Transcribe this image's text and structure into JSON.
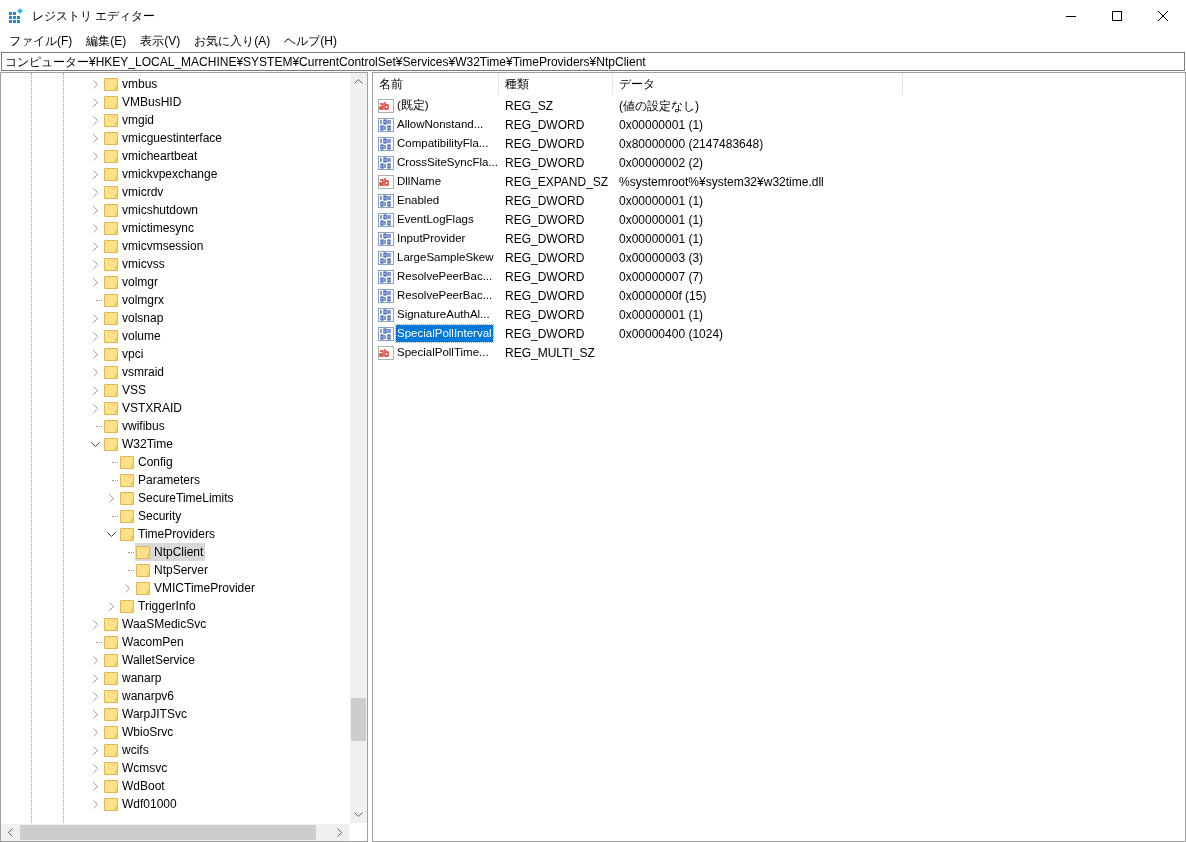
{
  "window": {
    "title": "レジストリ エディター"
  },
  "menu": [
    "ファイル(F)",
    "編集(E)",
    "表示(V)",
    "お気に入り(A)",
    "ヘルプ(H)"
  ],
  "address": "コンピューター¥HKEY_LOCAL_MACHINE¥SYSTEM¥CurrentControlSet¥Services¥W32Time¥TimeProviders¥NtpClient",
  "tree": [
    {
      "name": "vmbus",
      "has_children": true,
      "expanded": false,
      "selected": false
    },
    {
      "name": "VMBusHID",
      "has_children": true,
      "expanded": false,
      "selected": false
    },
    {
      "name": "vmgid",
      "has_children": true,
      "expanded": false,
      "selected": false
    },
    {
      "name": "vmicguestinterface",
      "has_children": true,
      "expanded": false,
      "selected": false
    },
    {
      "name": "vmicheartbeat",
      "has_children": true,
      "expanded": false,
      "selected": false
    },
    {
      "name": "vmickvpexchange",
      "has_children": true,
      "expanded": false,
      "selected": false
    },
    {
      "name": "vmicrdv",
      "has_children": true,
      "expanded": false,
      "selected": false
    },
    {
      "name": "vmicshutdown",
      "has_children": true,
      "expanded": false,
      "selected": false
    },
    {
      "name": "vmictimesync",
      "has_children": true,
      "expanded": false,
      "selected": false
    },
    {
      "name": "vmicvmsession",
      "has_children": true,
      "expanded": false,
      "selected": false
    },
    {
      "name": "vmicvss",
      "has_children": true,
      "expanded": false,
      "selected": false
    },
    {
      "name": "volmgr",
      "has_children": true,
      "expanded": false,
      "selected": false
    },
    {
      "name": "volmgrx",
      "has_children": false,
      "selected": false
    },
    {
      "name": "volsnap",
      "has_children": true,
      "expanded": false,
      "selected": false
    },
    {
      "name": "volume",
      "has_children": true,
      "expanded": false,
      "selected": false
    },
    {
      "name": "vpci",
      "has_children": true,
      "expanded": false,
      "selected": false
    },
    {
      "name": "vsmraid",
      "has_children": true,
      "expanded": false,
      "selected": false
    },
    {
      "name": "VSS",
      "has_children": true,
      "expanded": false,
      "selected": false
    },
    {
      "name": "VSTXRAID",
      "has_children": true,
      "expanded": false,
      "selected": false
    },
    {
      "name": "vwifibus",
      "has_children": false,
      "selected": false
    },
    {
      "name": "W32Time",
      "has_children": true,
      "expanded": true,
      "selected": false,
      "children": [
        {
          "name": "Config",
          "has_children": false,
          "selected": false
        },
        {
          "name": "Parameters",
          "has_children": false,
          "selected": false
        },
        {
          "name": "SecureTimeLimits",
          "has_children": true,
          "expanded": false,
          "selected": false
        },
        {
          "name": "Security",
          "has_children": false,
          "selected": false
        },
        {
          "name": "TimeProviders",
          "has_children": true,
          "expanded": true,
          "selected": false,
          "children": [
            {
              "name": "NtpClient",
              "has_children": false,
              "selected": true
            },
            {
              "name": "NtpServer",
              "has_children": false,
              "selected": false
            },
            {
              "name": "VMICTimeProvider",
              "has_children": true,
              "expanded": false,
              "selected": false
            }
          ]
        },
        {
          "name": "TriggerInfo",
          "has_children": true,
          "expanded": false,
          "selected": false
        }
      ]
    },
    {
      "name": "WaaSMedicSvc",
      "has_children": true,
      "expanded": false,
      "selected": false
    },
    {
      "name": "WacomPen",
      "has_children": false,
      "selected": false
    },
    {
      "name": "WalletService",
      "has_children": true,
      "expanded": false,
      "selected": false
    },
    {
      "name": "wanarp",
      "has_children": true,
      "expanded": false,
      "selected": false
    },
    {
      "name": "wanarpv6",
      "has_children": true,
      "expanded": false,
      "selected": false
    },
    {
      "name": "WarpJITSvc",
      "has_children": true,
      "expanded": false,
      "selected": false
    },
    {
      "name": "WbioSrvc",
      "has_children": true,
      "expanded": false,
      "selected": false
    },
    {
      "name": "wcifs",
      "has_children": true,
      "expanded": false,
      "selected": false
    },
    {
      "name": "Wcmsvc",
      "has_children": true,
      "expanded": false,
      "selected": false
    },
    {
      "name": "WdBoot",
      "has_children": true,
      "expanded": false,
      "selected": false
    },
    {
      "name": "Wdf01000",
      "has_children": true,
      "expanded": false,
      "selected": false
    }
  ],
  "table": {
    "columns": [
      "名前",
      "種類",
      "データ"
    ],
    "rows": [
      {
        "kind": "string",
        "name": "(既定)",
        "type": "REG_SZ",
        "data": "(値の設定なし)",
        "selected": false
      },
      {
        "kind": "binary",
        "name": "AllowNonstand...",
        "type": "REG_DWORD",
        "data": "0x00000001 (1)",
        "selected": false
      },
      {
        "kind": "binary",
        "name": "CompatibilityFla...",
        "type": "REG_DWORD",
        "data": "0x80000000 (2147483648)",
        "selected": false
      },
      {
        "kind": "binary",
        "name": "CrossSiteSyncFla...",
        "type": "REG_DWORD",
        "data": "0x00000002 (2)",
        "selected": false
      },
      {
        "kind": "string",
        "name": "DllName",
        "type": "REG_EXPAND_SZ",
        "data": "%systemroot%¥system32¥w32time.dll",
        "selected": false
      },
      {
        "kind": "binary",
        "name": "Enabled",
        "type": "REG_DWORD",
        "data": "0x00000001 (1)",
        "selected": false
      },
      {
        "kind": "binary",
        "name": "EventLogFlags",
        "type": "REG_DWORD",
        "data": "0x00000001 (1)",
        "selected": false
      },
      {
        "kind": "binary",
        "name": "InputProvider",
        "type": "REG_DWORD",
        "data": "0x00000001 (1)",
        "selected": false
      },
      {
        "kind": "binary",
        "name": "LargeSampleSkew",
        "type": "REG_DWORD",
        "data": "0x00000003 (3)",
        "selected": false
      },
      {
        "kind": "binary",
        "name": "ResolvePeerBac...",
        "type": "REG_DWORD",
        "data": "0x00000007 (7)",
        "selected": false
      },
      {
        "kind": "binary",
        "name": "ResolvePeerBac...",
        "type": "REG_DWORD",
        "data": "0x0000000f (15)",
        "selected": false
      },
      {
        "kind": "binary",
        "name": "SignatureAuthAl...",
        "type": "REG_DWORD",
        "data": "0x00000001 (1)",
        "selected": false
      },
      {
        "kind": "binary",
        "name": "SpecialPollInterval",
        "type": "REG_DWORD",
        "data": "0x00000400 (1024)",
        "selected": true
      },
      {
        "kind": "string",
        "name": "SpecialPollTime...",
        "type": "REG_MULTI_SZ",
        "selected": false
      }
    ]
  }
}
